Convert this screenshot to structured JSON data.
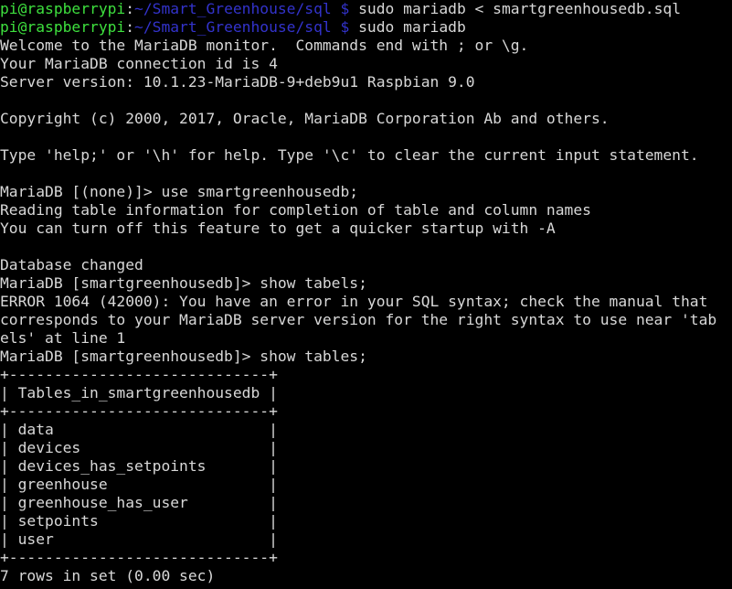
{
  "terminal": {
    "background_color": "#000000",
    "default_text_color": "#d8d8d8",
    "prompt_user_color": "#3ee03e",
    "prompt_path_color": "#3333cc",
    "shell_prompt": {
      "user_host": "pi@raspberrypi",
      "separator": ":",
      "path": "~/Smart_Greenhouse/sql",
      "sigil": "$"
    },
    "db_prompt_none": "MariaDB [(none)]> ",
    "db_prompt_db": "MariaDB [smartgreenhousedb]> ",
    "lines": [
      {
        "type": "shell_prompt",
        "command": " sudo mariadb < smartgreenhousedb.sql"
      },
      {
        "type": "shell_prompt",
        "command": " sudo mariadb"
      },
      {
        "type": "plain",
        "text": "Welcome to the MariaDB monitor.  Commands end with ; or \\g."
      },
      {
        "type": "plain",
        "text": "Your MariaDB connection id is 4"
      },
      {
        "type": "plain",
        "text": "Server version: 10.1.23-MariaDB-9+deb9u1 Raspbian 9.0"
      },
      {
        "type": "plain",
        "text": ""
      },
      {
        "type": "plain",
        "text": "Copyright (c) 2000, 2017, Oracle, MariaDB Corporation Ab and others."
      },
      {
        "type": "plain",
        "text": ""
      },
      {
        "type": "plain",
        "text": "Type 'help;' or '\\h' for help. Type '\\c' to clear the current input statement."
      },
      {
        "type": "plain",
        "text": ""
      },
      {
        "type": "plain",
        "text": "MariaDB [(none)]> use smartgreenhousedb;"
      },
      {
        "type": "plain",
        "text": "Reading table information for completion of table and column names"
      },
      {
        "type": "plain",
        "text": "You can turn off this feature to get a quicker startup with -A"
      },
      {
        "type": "plain",
        "text": ""
      },
      {
        "type": "plain",
        "text": "Database changed"
      },
      {
        "type": "plain",
        "text": "MariaDB [smartgreenhousedb]> show tabels;"
      },
      {
        "type": "plain",
        "text": "ERROR 1064 (42000): You have an error in your SQL syntax; check the manual that"
      },
      {
        "type": "plain",
        "text": "corresponds to your MariaDB server version for the right syntax to use near 'tab"
      },
      {
        "type": "plain",
        "text": "els' at line 1"
      },
      {
        "type": "plain",
        "text": "MariaDB [smartgreenhousedb]> show tables;"
      },
      {
        "type": "plain",
        "text": "+-----------------------------+"
      },
      {
        "type": "plain",
        "text": "| Tables_in_smartgreenhousedb |"
      },
      {
        "type": "plain",
        "text": "+-----------------------------+"
      },
      {
        "type": "plain",
        "text": "| data                        |"
      },
      {
        "type": "plain",
        "text": "| devices                     |"
      },
      {
        "type": "plain",
        "text": "| devices_has_setpoints       |"
      },
      {
        "type": "plain",
        "text": "| greenhouse                  |"
      },
      {
        "type": "plain",
        "text": "| greenhouse_has_user         |"
      },
      {
        "type": "plain",
        "text": "| setpoints                   |"
      },
      {
        "type": "plain",
        "text": "| user                        |"
      },
      {
        "type": "plain",
        "text": "+-----------------------------+"
      },
      {
        "type": "plain",
        "text": "7 rows in set (0.00 sec)"
      }
    ],
    "commands_run": [
      "sudo mariadb < smartgreenhousedb.sql",
      "sudo mariadb",
      "use smartgreenhousedb;",
      "show tabels;",
      "show tables;"
    ],
    "query_result": {
      "column_header": "Tables_in_smartgreenhousedb",
      "rows": [
        "data",
        "devices",
        "devices_has_setpoints",
        "greenhouse",
        "greenhouse_has_user",
        "setpoints",
        "user"
      ],
      "row_count_label": "7 rows in set (0.00 sec)",
      "border": "+-----------------------------+"
    },
    "error": {
      "code": "ERROR 1064 (42000)",
      "message": "You have an error in your SQL syntax; check the manual that corresponds to your MariaDB server version for the right syntax to use near 'tabels' at line 1"
    },
    "session_info": {
      "welcome": "Welcome to the MariaDB monitor.  Commands end with ; or \\g.",
      "connection_id": "Your MariaDB connection id is 4",
      "server_version": "Server version: 10.1.23-MariaDB-9+deb9u1 Raspbian 9.0",
      "copyright": "Copyright (c) 2000, 2017, Oracle, MariaDB Corporation Ab and others.",
      "help_hint": "Type 'help;' or '\\h' for help. Type '\\c' to clear the current input statement.",
      "reading_tables_1": "Reading table information for completion of table and column names",
      "reading_tables_2": "You can turn off this feature to get a quicker startup with -A",
      "database_changed": "Database changed"
    }
  }
}
